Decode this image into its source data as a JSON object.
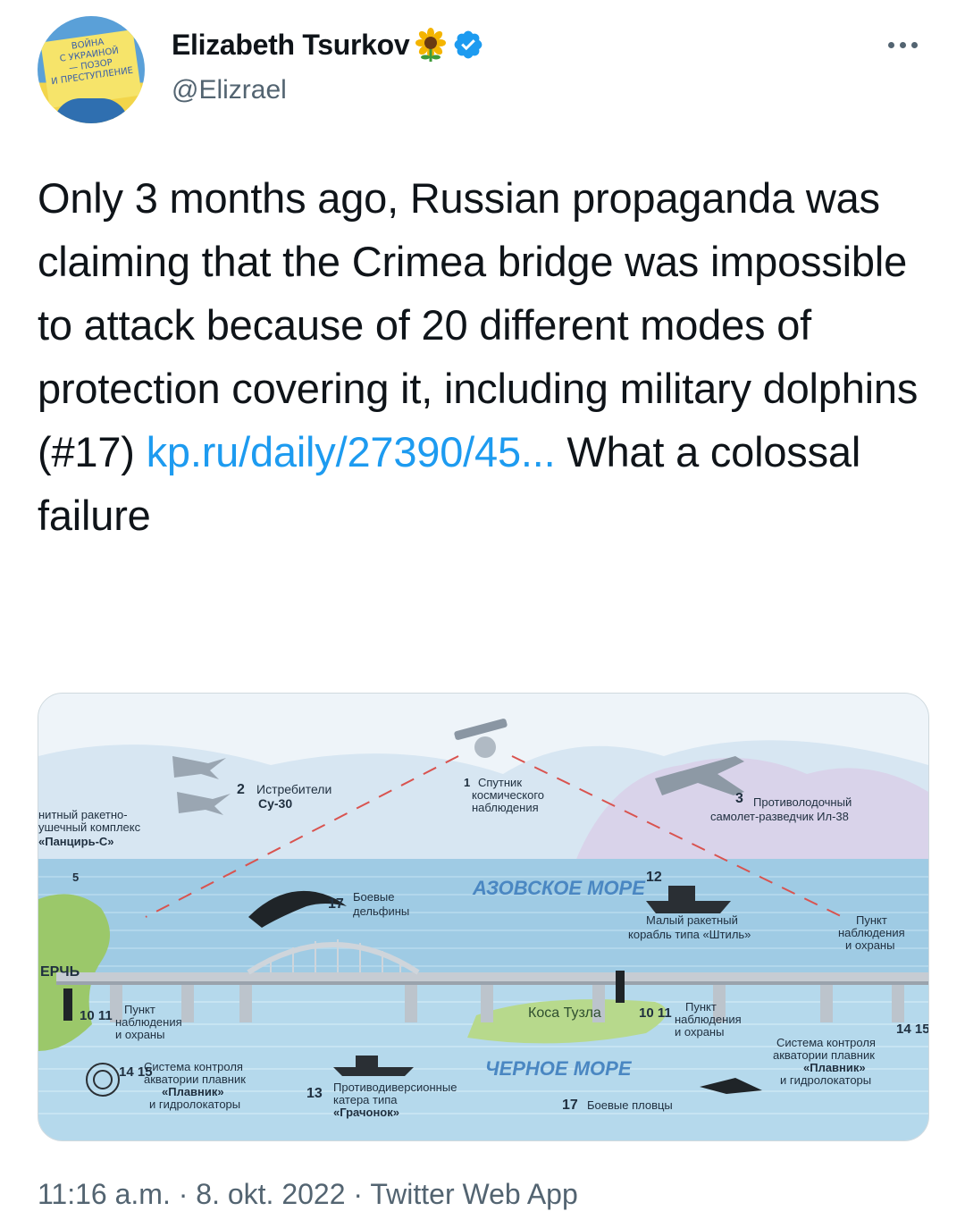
{
  "author": {
    "display_name": "Elizabeth Tsurkov",
    "handle": "@Elizrael",
    "verified": true,
    "emoji_icon": "sunflower-icon",
    "avatar_sign_lines": [
      "ВОЙНА",
      "С УКРАИНОЙ",
      "— ПОЗОР",
      "И ПРЕСТУПЛЕНИЕ"
    ]
  },
  "tweet": {
    "text_before_link": "Only 3 months ago, Russian propaganda was claiming that the Crimea bridge was impossible to attack because of 20 different modes of protection covering it, including military dolphins (#17) ",
    "link_text": "kp.ru/daily/27390/45...",
    "text_after_link": " What a colossal failure"
  },
  "infographic": {
    "sea_top": "АЗОВСКОЕ МОРЕ",
    "sea_bottom": "ЧЕРНОЕ МОРЕ",
    "spit": "Коса Тузла",
    "city": "ЕРЧЬ",
    "labels": [
      {
        "num": "1",
        "text": [
          "Спутник",
          "космического",
          "наблюдения"
        ]
      },
      {
        "num": "2",
        "text": [
          "Истребители",
          "Су-30"
        ]
      },
      {
        "num": "3",
        "text": [
          "Противолодочный",
          "самолет-разведчик Ил-38"
        ]
      },
      {
        "num": "5",
        "text": []
      },
      {
        "num": "",
        "text": [
          "нитный ракетно-",
          "ушечный комплекс",
          "«Панцирь-С»"
        ]
      },
      {
        "num": "12",
        "text": [
          "Малый ракетный",
          "корабль типа «Штиль»"
        ]
      },
      {
        "num": "17",
        "text": [
          "Боевые",
          "дельфины"
        ]
      },
      {
        "num": "10 11",
        "text": [
          "Пункт",
          "наблюдения",
          "и охраны"
        ]
      },
      {
        "num": "10 11",
        "text": [
          "Пункт",
          "наблюдения",
          "и охраны"
        ]
      },
      {
        "num": "",
        "text": [
          "Пункт",
          "наблюдения",
          "и охраны"
        ]
      },
      {
        "num": "14 15",
        "text": [
          "Система контроля",
          "акватории плавник",
          "«Плавник»",
          "и гидролокаторы"
        ]
      },
      {
        "num": "14 15",
        "text": [
          "Система контроля",
          "акватории плавник",
          "«Плавник»",
          "и гидролокаторы"
        ]
      },
      {
        "num": "13",
        "text": [
          "Противодиверсионные",
          "катера типа",
          "«Грачонок»"
        ]
      },
      {
        "num": "17",
        "text": [
          "Боевые пловцы"
        ]
      }
    ]
  },
  "meta": {
    "time": "11:16 a.m.",
    "sep1": " · ",
    "date": "8. okt. 2022",
    "sep2": " · ",
    "source": "Twitter Web App"
  },
  "colors": {
    "text": "#0f1419",
    "secondary": "#536471",
    "link": "#1d9bf0",
    "verified": "#1d9bf0",
    "sea": "#a9d4ea",
    "sky": "#dbe9f4"
  }
}
